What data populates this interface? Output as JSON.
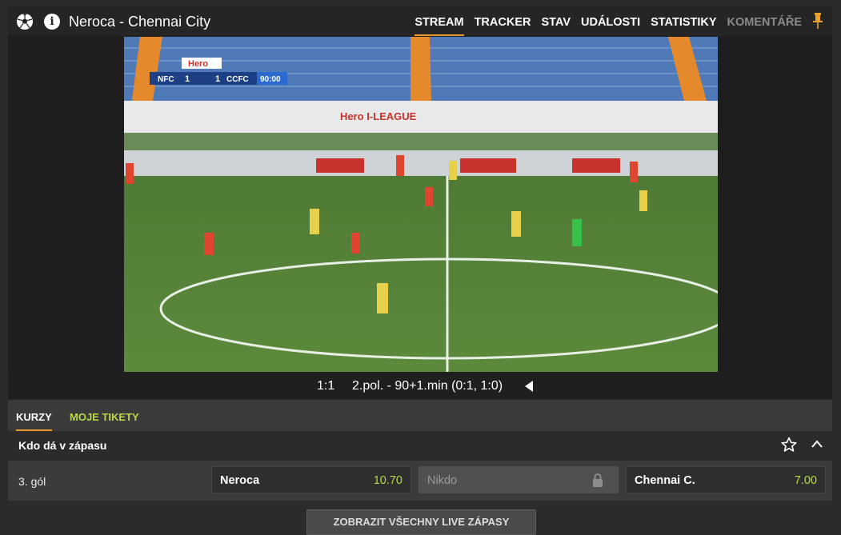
{
  "match": {
    "title": "Neroca - Chennai City"
  },
  "nav": {
    "tabs": [
      {
        "label": "STREAM",
        "active": true
      },
      {
        "label": "TRACKER"
      },
      {
        "label": "STAV"
      },
      {
        "label": "UDÁLOSTI"
      },
      {
        "label": "STATISTIKY"
      },
      {
        "label": "KOMENTÁŘE",
        "dim": true
      }
    ]
  },
  "video": {
    "overlay": {
      "brand": "Hero",
      "home": "NFC",
      "home_score": "1",
      "away_score": "1",
      "away": "CCFC",
      "clock": "90:00"
    },
    "banner_text": "Hero I-LEAGUE"
  },
  "score": {
    "result": "1:1",
    "status": "2.pol. - 90+1.min (0:1, 1:0)"
  },
  "odds_tabs": {
    "kurzy": "KURZY",
    "tickets": "MOJE TIKETY"
  },
  "market": {
    "title": "Kdo dá v zápasu",
    "row": {
      "label": "3. gól",
      "home": {
        "name": "Neroca",
        "odd": "10.70"
      },
      "none": {
        "name": "Nikdo"
      },
      "away": {
        "name": "Chennai C.",
        "odd": "7.00"
      }
    }
  },
  "show_all_label": "ZOBRAZIT VŠECHNY LIVE ZÁPASY",
  "colors": {
    "accent": "#e89a2c",
    "odd_green": "#b6d94a"
  }
}
